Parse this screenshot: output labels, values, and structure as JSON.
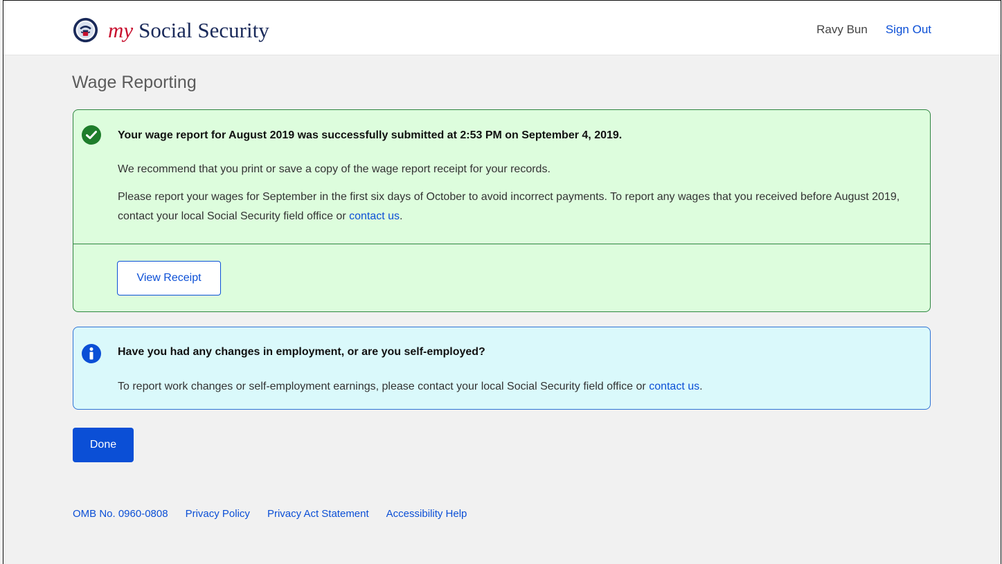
{
  "header": {
    "brand_my": "my",
    "brand_name": "Social Security",
    "seal_icon": "ssa-seal-icon",
    "user_name": "Ravy Bun",
    "sign_out": "Sign Out"
  },
  "page": {
    "title": "Wage Reporting"
  },
  "success_alert": {
    "icon": "check-circle-icon",
    "heading": "Your wage report for August 2019 was successfully submitted at 2:53 PM on September 4, 2019.",
    "paragraph1": "We recommend that you print or save a copy of the wage report receipt for your records.",
    "paragraph2_text": "Please report your wages for September in the first six days of October to avoid incorrect payments. To report any wages that you received before August 2019, contact your local Social Security field office or ",
    "paragraph2_link": "contact us",
    "paragraph2_end": ".",
    "button_label": "View Receipt"
  },
  "info_alert": {
    "icon": "info-circle-icon",
    "heading": "Have you had any changes in employment, or are you self-employed?",
    "paragraph_text": "To report work changes or self-employment earnings, please contact your local Social Security field office or ",
    "paragraph_link": "contact us",
    "paragraph_end": "."
  },
  "actions": {
    "done_label": "Done"
  },
  "footer": {
    "links": [
      "OMB No. 0960-0808",
      "Privacy Policy",
      "Privacy Act Statement",
      "Accessibility Help"
    ]
  },
  "colors": {
    "link_blue": "#0b4fd6",
    "success_bg": "#ddfddd",
    "success_border": "#2e8540",
    "info_bg": "#daf9fb",
    "info_border": "#2f73d5",
    "brand_red": "#c8102e",
    "brand_navy": "#1a2a5a"
  }
}
